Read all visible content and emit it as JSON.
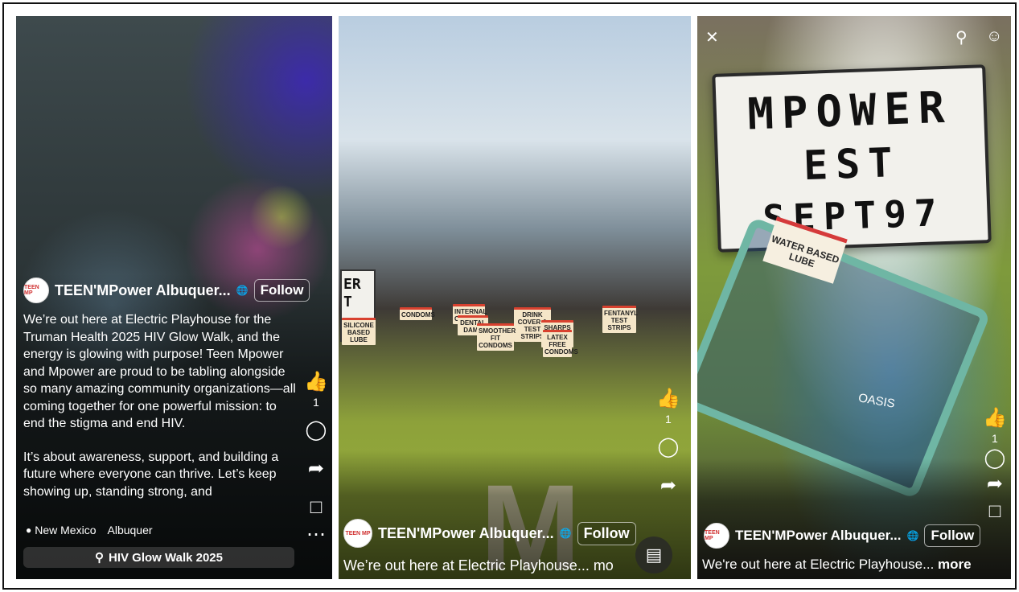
{
  "post": {
    "author": "TEEN'MPower Albuquer...",
    "avatar_text": "TEEN MP",
    "follow_label": "Follow",
    "like_count": "1"
  },
  "panel1": {
    "caption_p1": "We’re out here at Electric Playhouse for the Truman Health 2025 HIV Glow Walk, and the energy is glowing with purpose! Teen Mpower and Mpower are proud to be tabling alongside so many amazing community organizations—all coming together for one powerful mission: to end the stigma and end HIV.",
    "caption_p2": "It’s about awareness, support, and building a future where everyone can thrive. Let’s keep showing up, standing strong, and",
    "location": "New Mexico",
    "location_city": "Albuquer",
    "search_label": "HIV Glow Walk 2025"
  },
  "panel2": {
    "caption_short": "We’re out here at Electric Playhouse... mo",
    "lightbox_text": "ER T",
    "table_signs": [
      "SILICONE BASED LUBE",
      "CONDOMS",
      "INTERNAL CONDOMS",
      "DENTAL DAMS",
      "DRINK COVER & TEST STRIPS",
      "SHARPS TEST STRIPS",
      "SMOOTHER FIT CONDOMS",
      "LATEX FREE CONDOMS",
      "FENTANYL TEST STRIPS"
    ]
  },
  "panel3": {
    "sign_line1": "MPOWER",
    "sign_line2": "EST",
    "sign_line3": "SEPT97",
    "lube_label": "WATER BASED LUBE",
    "oasis_label": "OASIS",
    "caption_short": "We're out here at Electric Playhouse...",
    "more_label": "more"
  },
  "icons": {
    "like": "thumbs-up-icon",
    "comment": "comment-icon",
    "share": "share-icon",
    "save": "bookmark-icon",
    "menu": "more-icon",
    "close": "close-icon",
    "search": "search-icon",
    "profile": "profile-icon",
    "scan": "text-scan-icon"
  }
}
